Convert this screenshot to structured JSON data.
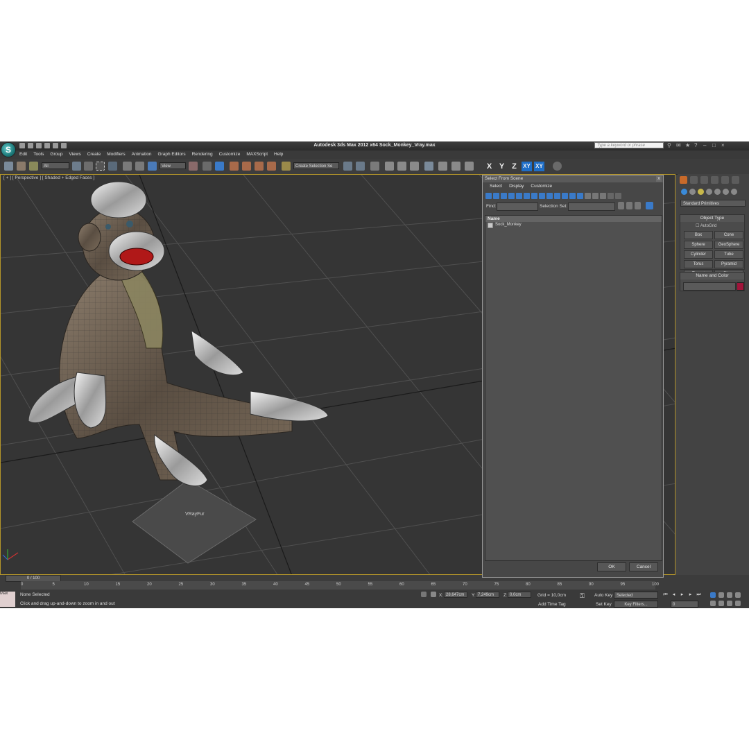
{
  "window": {
    "title": "Autodesk 3ds Max  2012 x64     Sock_Monkey_Vray.max",
    "search_placeholder": "Type a keyword or phrase"
  },
  "menu": [
    "Edit",
    "Tools",
    "Group",
    "Views",
    "Create",
    "Modifiers",
    "Animation",
    "Graph Editors",
    "Rendering",
    "Customize",
    "MAXScript",
    "Help"
  ],
  "toolbar": {
    "filter_value": "All",
    "refcoord_value": "View",
    "selection_set_placeholder": "Create Selection Se",
    "axes": [
      "X",
      "Y",
      "Z",
      "XY",
      "XY"
    ]
  },
  "viewport": {
    "label": "[ + ] [ Perspective ] [ Shaded + Edged Faces ]",
    "helper_label": "VRayFur"
  },
  "dialog": {
    "title": "Select From Scene",
    "close_glyph": "x",
    "menu": [
      "Select",
      "Display",
      "Customize"
    ],
    "find_label": "Find:",
    "selection_set_label": "Selection Set:",
    "column_header": "Name",
    "rows": [
      "Sock_Monkey"
    ],
    "ok_label": "OK",
    "cancel_label": "Cancel"
  },
  "command_panel": {
    "category": "Standard Primitives",
    "object_type_title": "Object Type",
    "autogrid_label": "AutoGrid",
    "primitives": [
      "Box",
      "Cone",
      "Sphere",
      "GeoSphere",
      "Cylinder",
      "Tube",
      "Torus",
      "Pyramid",
      "Teapot",
      "Plane"
    ],
    "name_color_title": "Name and Color",
    "object_color": "#a0143a"
  },
  "timeline": {
    "frame_slider": "0 / 100",
    "ticks": [
      "0",
      "5",
      "10",
      "15",
      "20",
      "25",
      "30",
      "35",
      "40",
      "45",
      "50",
      "55",
      "60",
      "65",
      "70",
      "75",
      "80",
      "85",
      "90",
      "95",
      "100"
    ]
  },
  "status": {
    "selection": "None Selected",
    "prompt": "Click and drag up-and-down to zoom in and out",
    "maxscript_label": "Max",
    "x_label": "X:",
    "x_value": "28,647cm",
    "y_label": "Y:",
    "y_value": "7,249cm",
    "z_label": "Z:",
    "z_value": "0,0cm",
    "grid": "Grid = 10,0cm",
    "add_time_tag": "Add Time Tag",
    "auto_key": "Auto Key",
    "set_key": "Set Key",
    "selected_dropdown": "Selected",
    "key_filters": "Key Filters...",
    "current_frame": "0"
  }
}
